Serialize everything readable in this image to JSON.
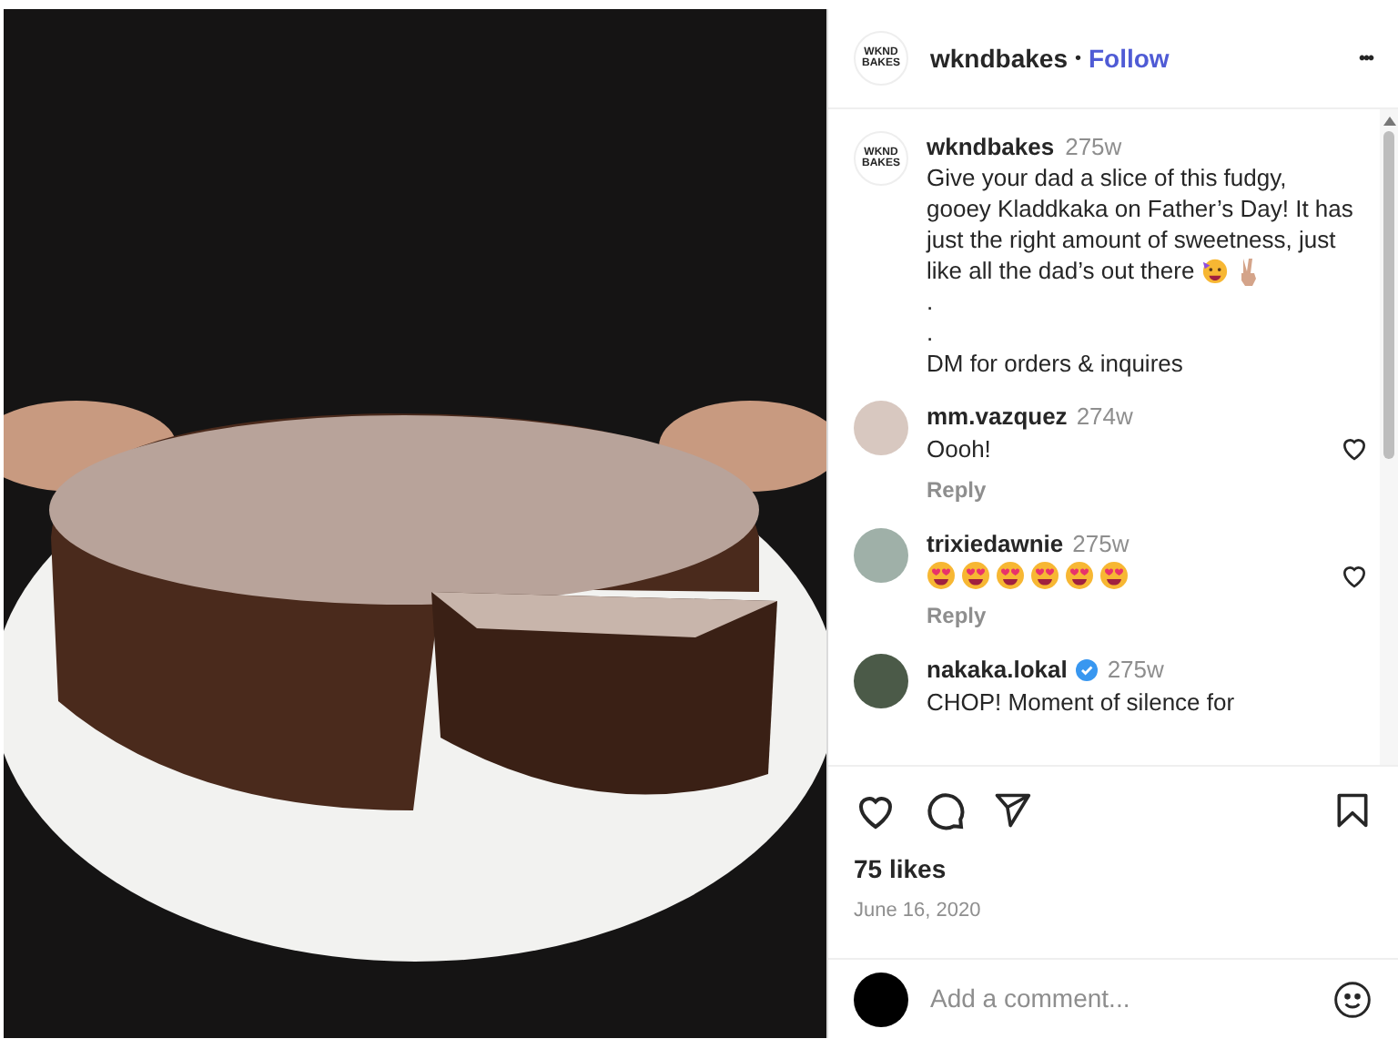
{
  "post": {
    "author": "wkndbakes",
    "separator": "•",
    "follow": "Follow",
    "more": "•••",
    "avatar_text": "WKND BAKES"
  },
  "caption": {
    "avatar_text": "WKND BAKES",
    "author": "wkndbakes",
    "time": "275w",
    "lines": [
      {
        "text": "Give your dad a slice of this fudgy,"
      },
      {
        "text": "gooey Kladdkaka on Father’s Day! It has"
      },
      {
        "text": "just the right amount of sweetness, just"
      },
      {
        "text": "like all the dad’s out there",
        "emojis": [
          {
            "kind": "party"
          },
          {
            "kind": "victory"
          }
        ]
      },
      {
        "text": "."
      },
      {
        "text": "."
      },
      {
        "text": "DM for orders & inquires"
      }
    ]
  },
  "comments": [
    {
      "author": "mm.vazquez",
      "time": "274w",
      "text": "Oooh!",
      "liked": false,
      "reply": "Reply"
    },
    {
      "author": "trixiedawnie",
      "time": "275w",
      "liked": false,
      "reply": "Reply",
      "reactions": [
        {
          "kind": "heart-eyes"
        },
        {
          "kind": "heart-eyes"
        },
        {
          "kind": "heart-eyes"
        },
        {
          "kind": "heart-eyes"
        },
        {
          "kind": "heart-eyes"
        },
        {
          "kind": "heart-eyes"
        }
      ]
    },
    {
      "author": "nakaka.lokal",
      "time": "275w",
      "text": "CHOP! Moment of silence for",
      "verified": true
    }
  ],
  "actions": {
    "liked": false,
    "saved": false
  },
  "likes": "75 likes",
  "date": "June 16, 2020",
  "comment_field": {
    "placeholder": "Add a comment..."
  }
}
